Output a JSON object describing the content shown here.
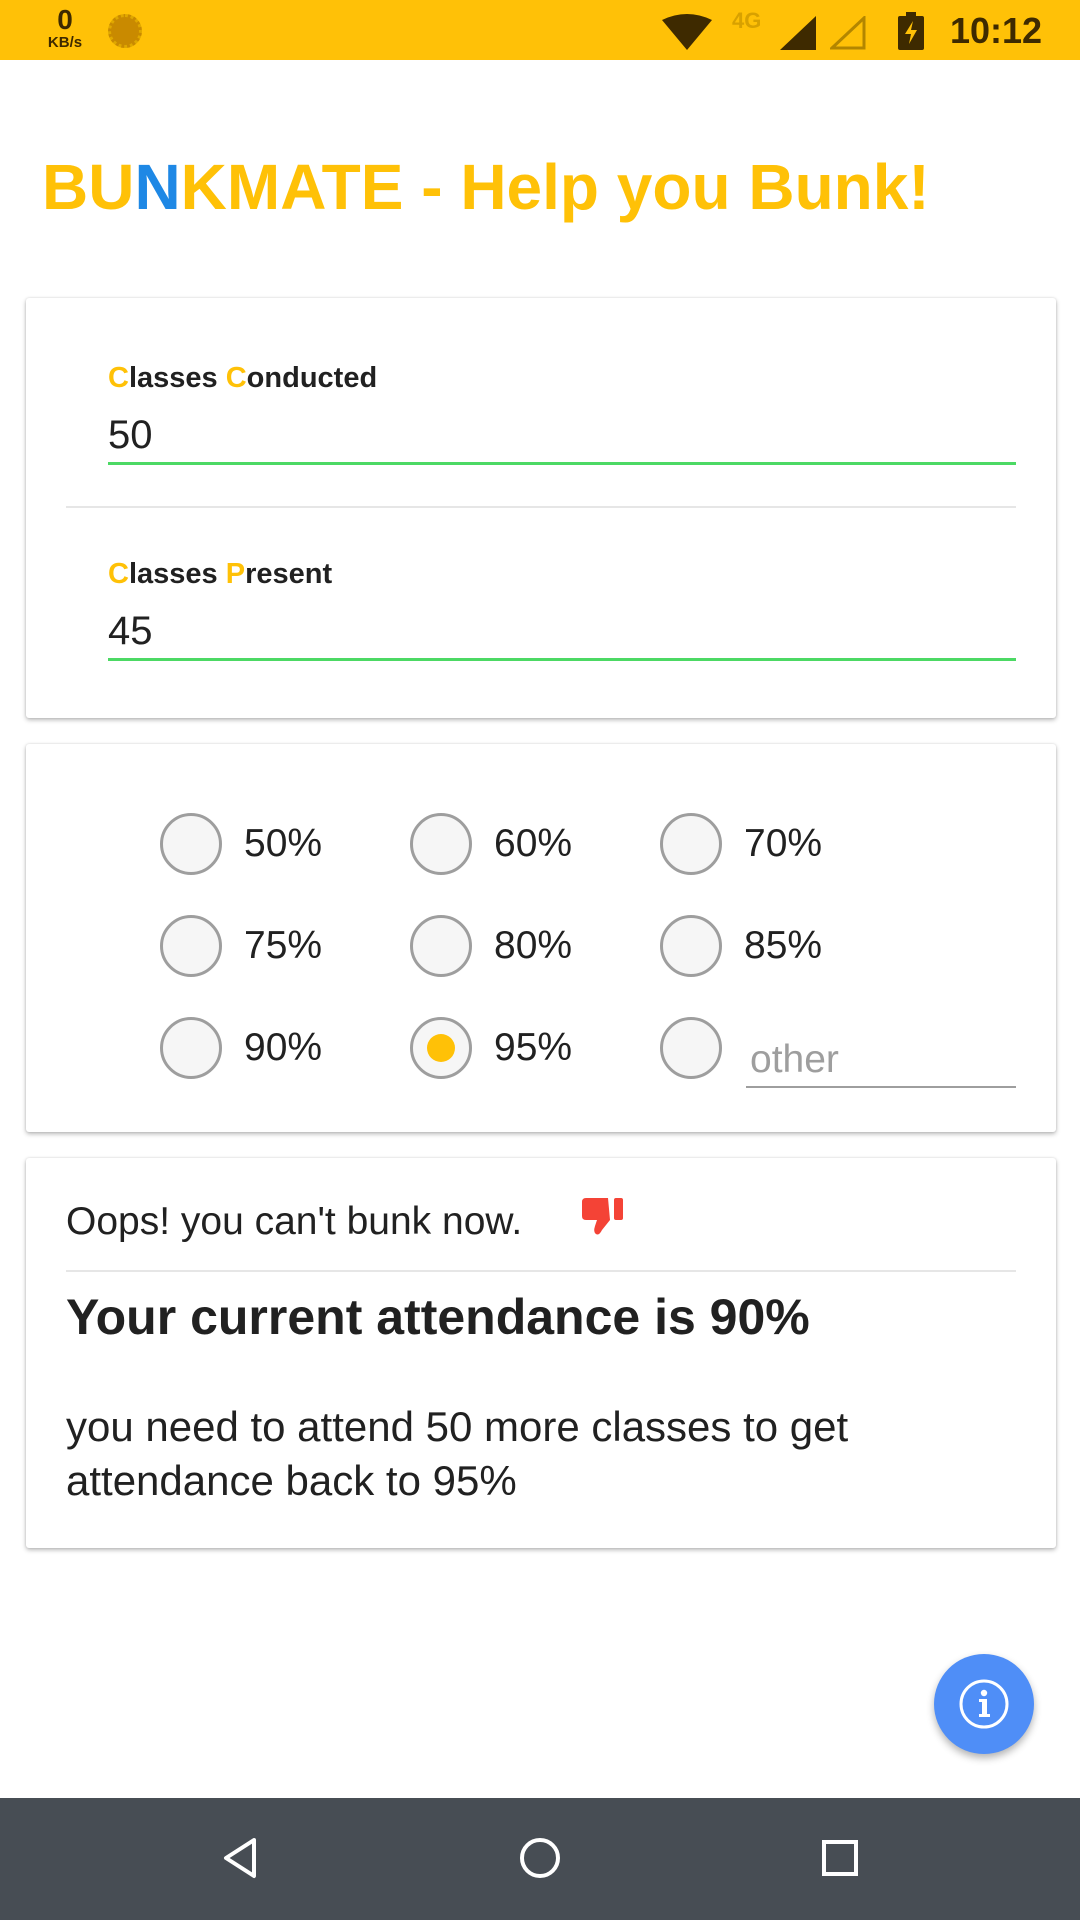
{
  "status_bar": {
    "speed_value": "0",
    "speed_unit": "KB/s",
    "network": "4G",
    "time": "10:12",
    "icons": [
      "sun-icon",
      "wifi-icon",
      "signal-icon",
      "signal-empty-icon",
      "battery-charging-icon"
    ]
  },
  "header": {
    "title_part1": "BU",
    "title_accent": "N",
    "title_part2": "KMATE - Help you Bunk!",
    "colors": {
      "primary": "#FFC107",
      "accent": "#1E88E5"
    }
  },
  "inputs": {
    "conducted": {
      "label_initial1": "C",
      "label_rest1": "lasses ",
      "label_initial2": "C",
      "label_rest2": "onducted",
      "value": "50"
    },
    "present": {
      "label_initial1": "C",
      "label_rest1": "lasses ",
      "label_initial2": "P",
      "label_rest2": "resent",
      "value": "45"
    },
    "underline_color": "#4CD964"
  },
  "target": {
    "options": [
      {
        "label": "50%",
        "checked": false
      },
      {
        "label": "60%",
        "checked": false
      },
      {
        "label": "70%",
        "checked": false
      },
      {
        "label": "75%",
        "checked": false
      },
      {
        "label": "80%",
        "checked": false
      },
      {
        "label": "85%",
        "checked": false
      },
      {
        "label": "90%",
        "checked": false
      },
      {
        "label": "95%",
        "checked": true
      },
      {
        "label": "",
        "checked": false
      }
    ],
    "other_placeholder": "other"
  },
  "result": {
    "status": "Oops! you can't bunk now.",
    "status_icon": "thumbs-down-icon",
    "attendance": "Your current attendance is 90%",
    "advice": "you need to attend 50 more classes to get attendance back to 95%"
  },
  "fab": {
    "icon": "info-icon",
    "color": "#4F8EF7"
  },
  "nav_bar": {
    "icons": [
      "back-icon",
      "home-icon",
      "recents-icon"
    ]
  }
}
